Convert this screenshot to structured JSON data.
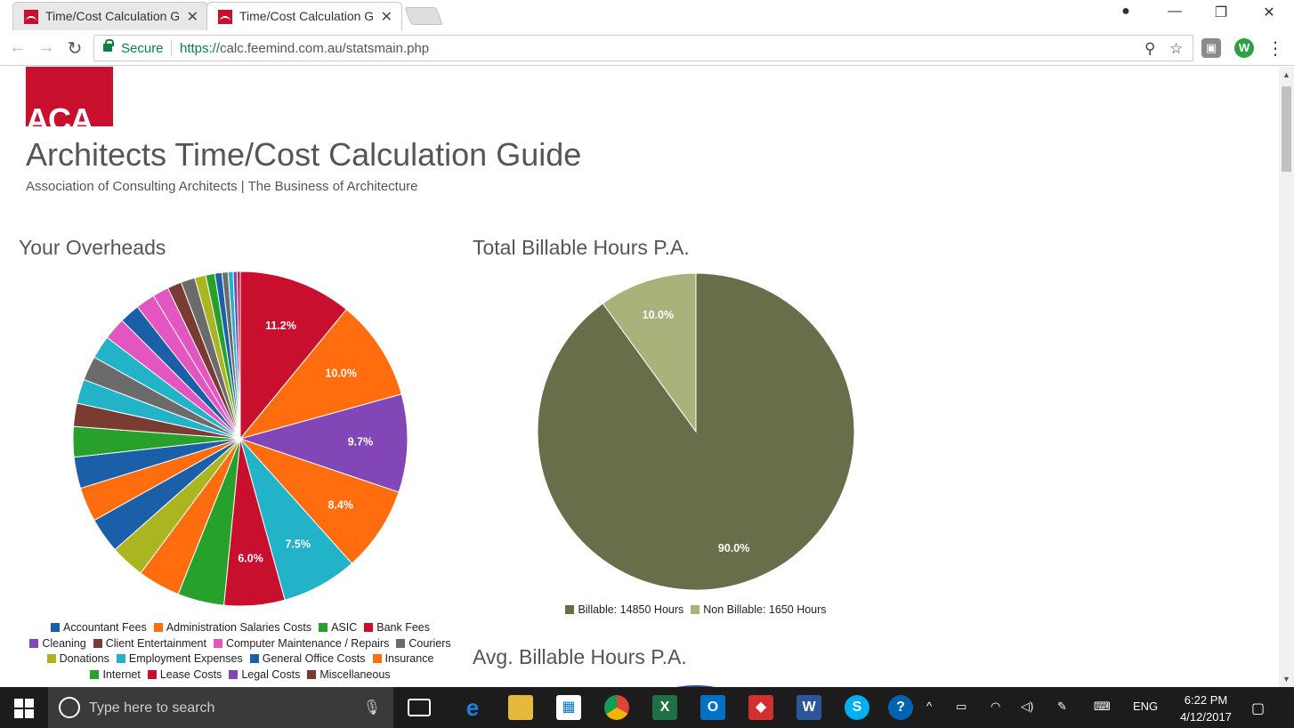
{
  "browser": {
    "tabs": [
      {
        "title": "Time/Cost Calculation Gu",
        "active": false
      },
      {
        "title": "Time/Cost Calculation Gu",
        "active": true
      }
    ],
    "secure_label": "Secure",
    "url_scheme": "https://",
    "url_rest": "calc.feemind.com.au/statsmain.php"
  },
  "page": {
    "logo_text": "ACA",
    "title": "Architects Time/Cost Calculation Guide",
    "subtitle": "Association of Consulting Architects | The Business of Architecture",
    "overheads_heading": "Your Overheads",
    "billable_heading": "Total Billable Hours P.A.",
    "avg_heading": "Avg. Billable Hours P.A."
  },
  "chart_data": [
    {
      "type": "pie",
      "title": "Your Overheads",
      "slices": [
        {
          "label": "",
          "value": 11.2,
          "color": "#c8102e",
          "show": "11.2%"
        },
        {
          "label": "",
          "value": 10.0,
          "color": "#ff6d0f",
          "show": "10.0%"
        },
        {
          "label": "",
          "value": 9.7,
          "color": "#8346b6",
          "show": "9.7%"
        },
        {
          "label": "",
          "value": 8.4,
          "color": "#ff6d0f",
          "show": "8.4%"
        },
        {
          "label": "",
          "value": 7.5,
          "color": "#22b3c8",
          "show": "7.5%"
        },
        {
          "label": "",
          "value": 6.0,
          "color": "#c8102e",
          "show": "6.0%"
        },
        {
          "label": "",
          "value": 4.6,
          "color": "#27a02c",
          "show": ""
        },
        {
          "label": "",
          "value": 4.2,
          "color": "#ff6d0f",
          "show": ""
        },
        {
          "label": "",
          "value": 3.4,
          "color": "#aab521",
          "show": ""
        },
        {
          "label": "",
          "value": 3.5,
          "color": "#1a5fa8",
          "show": ""
        },
        {
          "label": "",
          "value": 3.4,
          "color": "#ff6d0f",
          "show": ""
        },
        {
          "label": "",
          "value": 3.1,
          "color": "#1a5fa8",
          "show": ""
        },
        {
          "label": "",
          "value": 3.0,
          "color": "#27a02c",
          "show": ""
        },
        {
          "label": "",
          "value": 2.3,
          "color": "#7a3b33",
          "show": ""
        },
        {
          "label": "",
          "value": 2.4,
          "color": "#22b3c8",
          "show": ""
        },
        {
          "label": "",
          "value": 2.4,
          "color": "#6b6b6b",
          "show": ""
        },
        {
          "label": "",
          "value": 2.3,
          "color": "#22b3c8",
          "show": ""
        },
        {
          "label": "",
          "value": 2.2,
          "color": "#e355c0",
          "show": ""
        },
        {
          "label": "",
          "value": 2.0,
          "color": "#1a5fa8",
          "show": ""
        },
        {
          "label": "",
          "value": 1.9,
          "color": "#e355c0",
          "show": ""
        },
        {
          "label": "",
          "value": 1.6,
          "color": "#e355c0",
          "show": ""
        },
        {
          "label": "",
          "value": 1.4,
          "color": "#7a3b33",
          "show": ""
        },
        {
          "label": "",
          "value": 1.4,
          "color": "#6b6b6b",
          "show": ""
        },
        {
          "label": "",
          "value": 1.1,
          "color": "#aab521",
          "show": ""
        },
        {
          "label": "",
          "value": 0.9,
          "color": "#27a02c",
          "show": ""
        },
        {
          "label": "",
          "value": 0.7,
          "color": "#1a5fa8",
          "show": ""
        },
        {
          "label": "",
          "value": 0.6,
          "color": "#6b6b6b",
          "show": ""
        },
        {
          "label": "",
          "value": 0.5,
          "color": "#22b3c8",
          "show": ""
        },
        {
          "label": "",
          "value": 0.4,
          "color": "#8346b6",
          "show": ""
        },
        {
          "label": "",
          "value": 0.3,
          "color": "#c8102e",
          "show": ""
        }
      ],
      "legend": [
        {
          "label": "Accountant Fees",
          "color": "#1a5fa8"
        },
        {
          "label": "Administration Salaries Costs",
          "color": "#ff6d0f"
        },
        {
          "label": "ASIC",
          "color": "#27a02c"
        },
        {
          "label": "Bank Fees",
          "color": "#c8102e"
        },
        {
          "label": "Cleaning",
          "color": "#8346b6"
        },
        {
          "label": "Client Entertainment",
          "color": "#7a3b33"
        },
        {
          "label": "Computer Maintenance / Repairs",
          "color": "#e355c0"
        },
        {
          "label": "Couriers",
          "color": "#6b6b6b"
        },
        {
          "label": "Donations",
          "color": "#aab521"
        },
        {
          "label": "Employment Expenses",
          "color": "#22b3c8"
        },
        {
          "label": "General Office Costs",
          "color": "#1a5fa8"
        },
        {
          "label": "Insurance",
          "color": "#ff6d0f"
        },
        {
          "label": "Internet",
          "color": "#27a02c"
        },
        {
          "label": "Lease Costs",
          "color": "#c8102e"
        },
        {
          "label": "Legal Costs",
          "color": "#8346b6"
        },
        {
          "label": "Miscellaneous",
          "color": "#7a3b33"
        }
      ]
    },
    {
      "type": "pie",
      "title": "Total Billable Hours P.A.",
      "slices": [
        {
          "label": "Billable: 14850 Hours",
          "value": 90.0,
          "color": "#666f4a",
          "show": "90.0%"
        },
        {
          "label": "Non Billable: 1650 Hours",
          "value": 10.0,
          "color": "#a9b27b",
          "show": "10.0%"
        }
      ]
    }
  ],
  "taskbar": {
    "search_placeholder": "Type here to search",
    "language": "ENG",
    "time": "6:22 PM",
    "date": "4/12/2017"
  }
}
